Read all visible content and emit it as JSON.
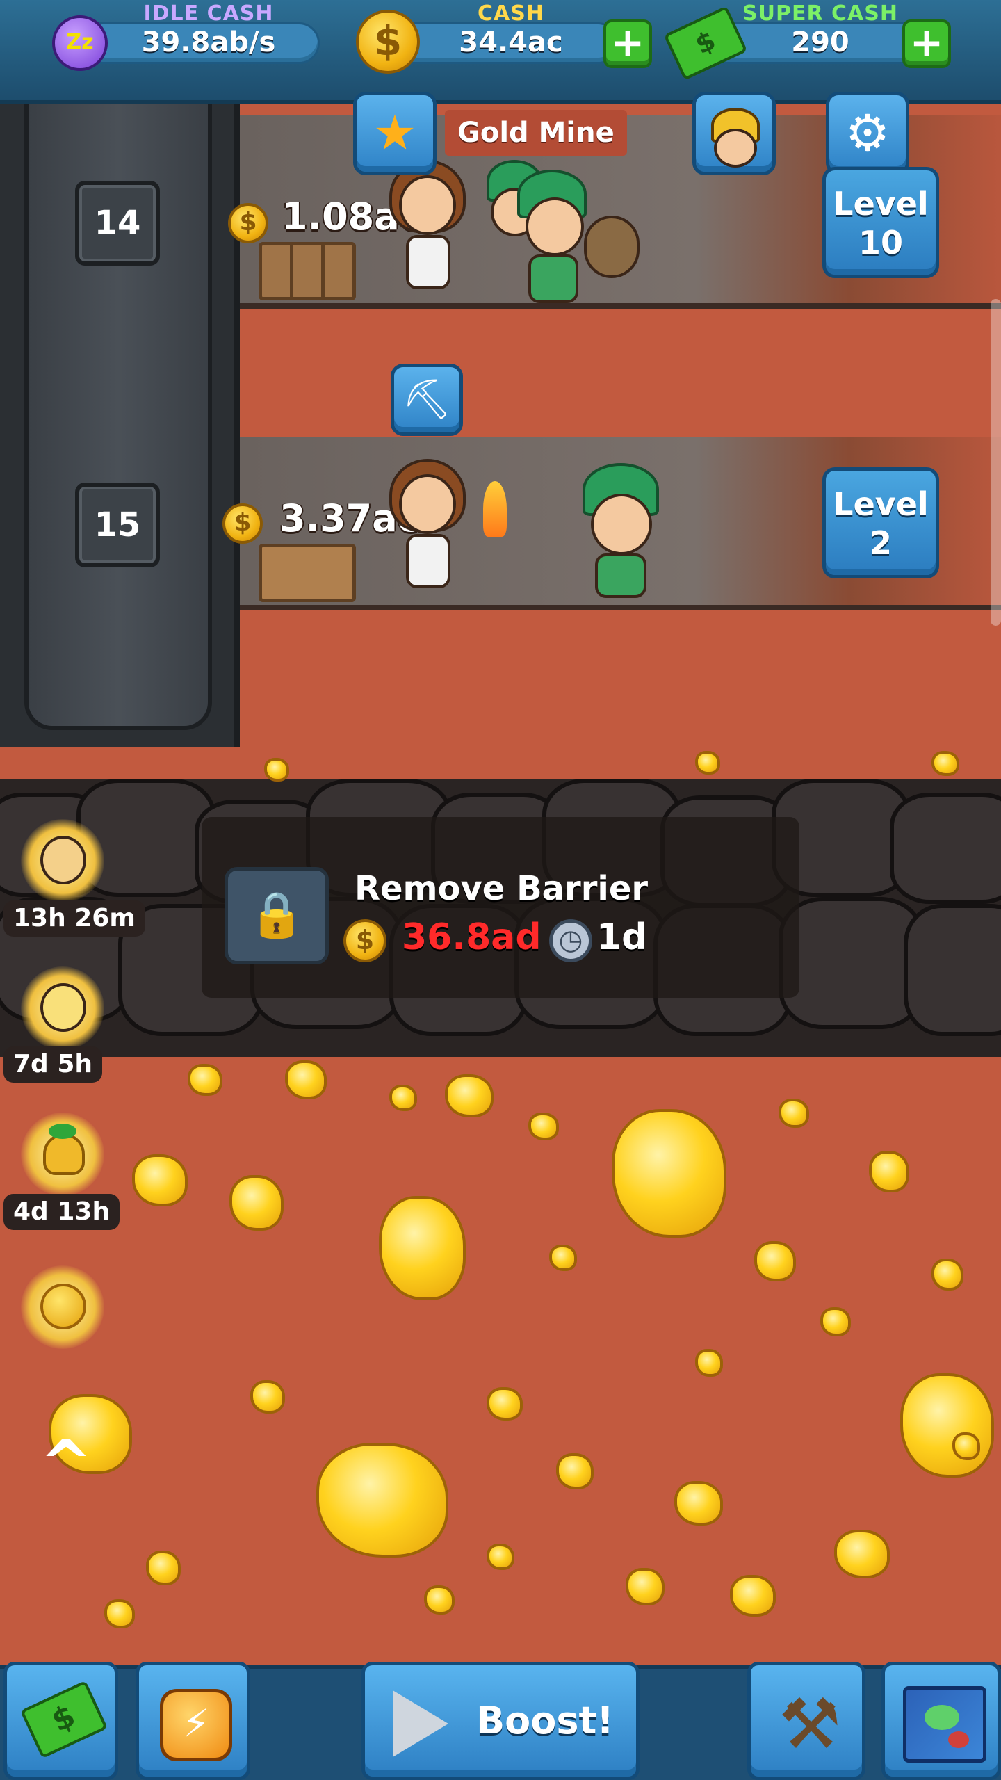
{
  "topbar": {
    "idle_cash": {
      "label": "IDLE CASH",
      "value": "39.8ab/s",
      "label_color": "#c9a8ff"
    },
    "cash": {
      "label": "CASH",
      "value": "34.4ac",
      "label_color": "#ffd84a"
    },
    "super_cash": {
      "label": "SUPER CASH",
      "value": "290",
      "label_color": "#7cf067"
    }
  },
  "mine": {
    "name": "Gold Mine"
  },
  "floors": [
    {
      "number": "14",
      "money": "1.08ac",
      "level_label": "Level",
      "level": "10"
    },
    {
      "number": "15",
      "money": "3.37ac",
      "level_label": "Level",
      "level": "2"
    }
  ],
  "barrier": {
    "title": "Remove Barrier",
    "cost": "36.8ad",
    "cost_color": "#ff2a2a",
    "time": "1d"
  },
  "boost_timers": [
    "13h 26m",
    "7d 5h",
    "4d 13h"
  ],
  "bottombar": {
    "boost_label": "Boost!"
  },
  "icons": {
    "zzz": "zzz-icon",
    "coin": "coin-icon",
    "cash_stack": "cash-stack-icon",
    "star": "star-icon",
    "manager": "manager-icon",
    "gear": "gear-icon",
    "pickaxe": "pickaxe-icon",
    "lock": "lock-icon",
    "clock": "clock-icon",
    "chevron_up": "chevron-up-icon",
    "play": "play-icon",
    "map": "map-icon"
  }
}
